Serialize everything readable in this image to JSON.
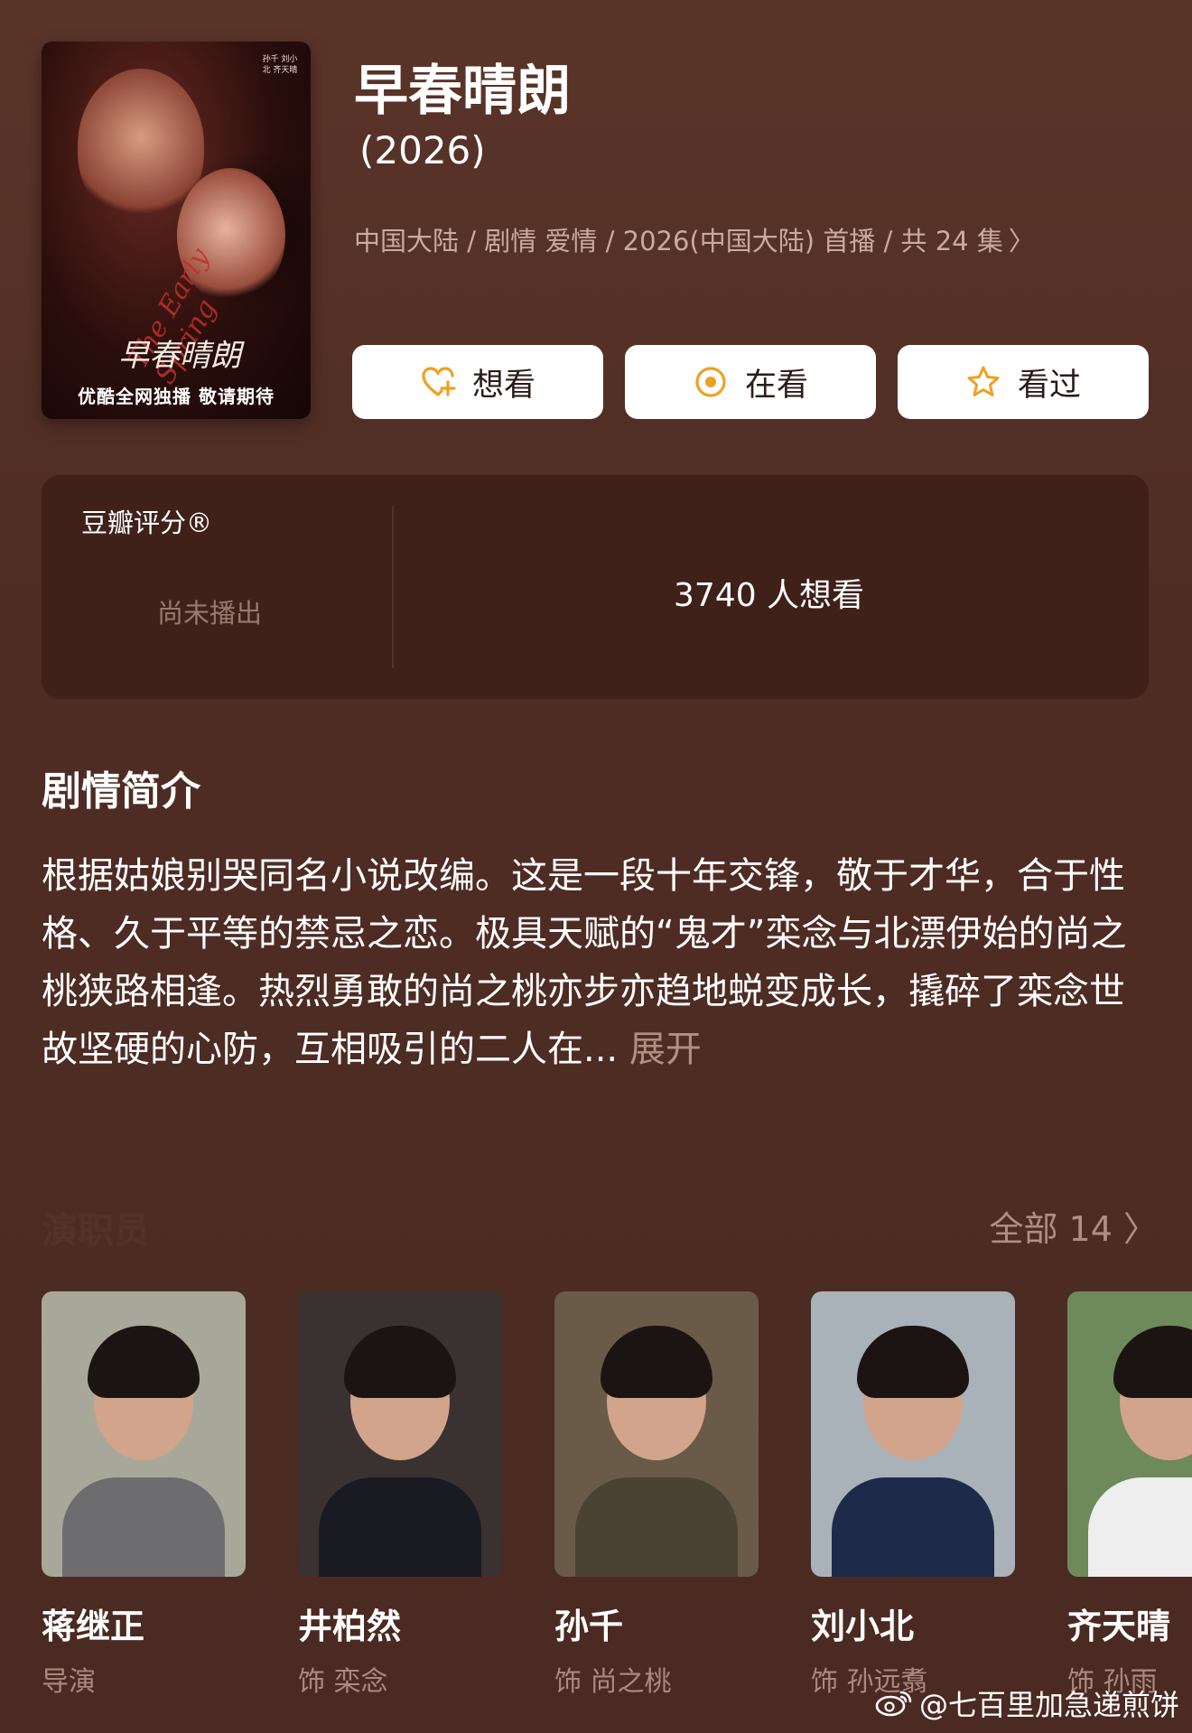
{
  "poster": {
    "bottom_text": "优酷全网独播 敬请期待",
    "script_text": "The Early Spring",
    "title_art": "早春晴朗",
    "credits": "孙千 刘小北 齐天晴"
  },
  "show": {
    "title": "早春晴朗",
    "year": "(2026)",
    "meta": "中国大陆 / 剧情 爱情 / 2026(中国大陆) 首播 / 共 24 集",
    "meta_chevron": "〉"
  },
  "actions": [
    {
      "label": "想看",
      "icon": "heart-plus-icon"
    },
    {
      "label": "在看",
      "icon": "target-icon"
    },
    {
      "label": "看过",
      "icon": "star-icon"
    }
  ],
  "rating": {
    "label": "豆瓣评分®",
    "status": "尚未播出",
    "wish_count": "3740 人想看"
  },
  "synopsis": {
    "title": "剧情简介",
    "text": "根据姑娘别哭同名小说改编。这是一段十年交锋，敬于才华，合于性格、久于平等的禁忌之恋。极具天赋的“鬼才”栾念与北漂伊始的尚之桃狭路相逢。热烈勇敢的尚之桃亦步亦趋地蜕变成长，撬碎了栾念世故坚硬的心防，互相吸引的二人在...",
    "more": "展开"
  },
  "cast": {
    "title": "演职员",
    "all_label": "全部 14",
    "all_chevron": "〉",
    "people": [
      {
        "name": "蒋继正",
        "role": "导演",
        "colors": {
          "bg": "#a8a89a",
          "body": "#6d6d70"
        }
      },
      {
        "name": "井柏然",
        "role": "饰 栾念",
        "colors": {
          "bg": "#3a3230",
          "body": "#1a1a22"
        }
      },
      {
        "name": "孙千",
        "role": "饰 尚之桃",
        "colors": {
          "bg": "#6a5a48",
          "body": "#4a4232"
        }
      },
      {
        "name": "刘小北",
        "role": "饰 孙远翥",
        "colors": {
          "bg": "#a9b2b8",
          "body": "#1d2a4a"
        }
      },
      {
        "name": "齐天晴",
        "role": "饰 孙雨",
        "colors": {
          "bg": "#6f8a5a",
          "body": "#eeeeee"
        }
      }
    ]
  },
  "watermark": "@七百里加急递煎饼"
}
